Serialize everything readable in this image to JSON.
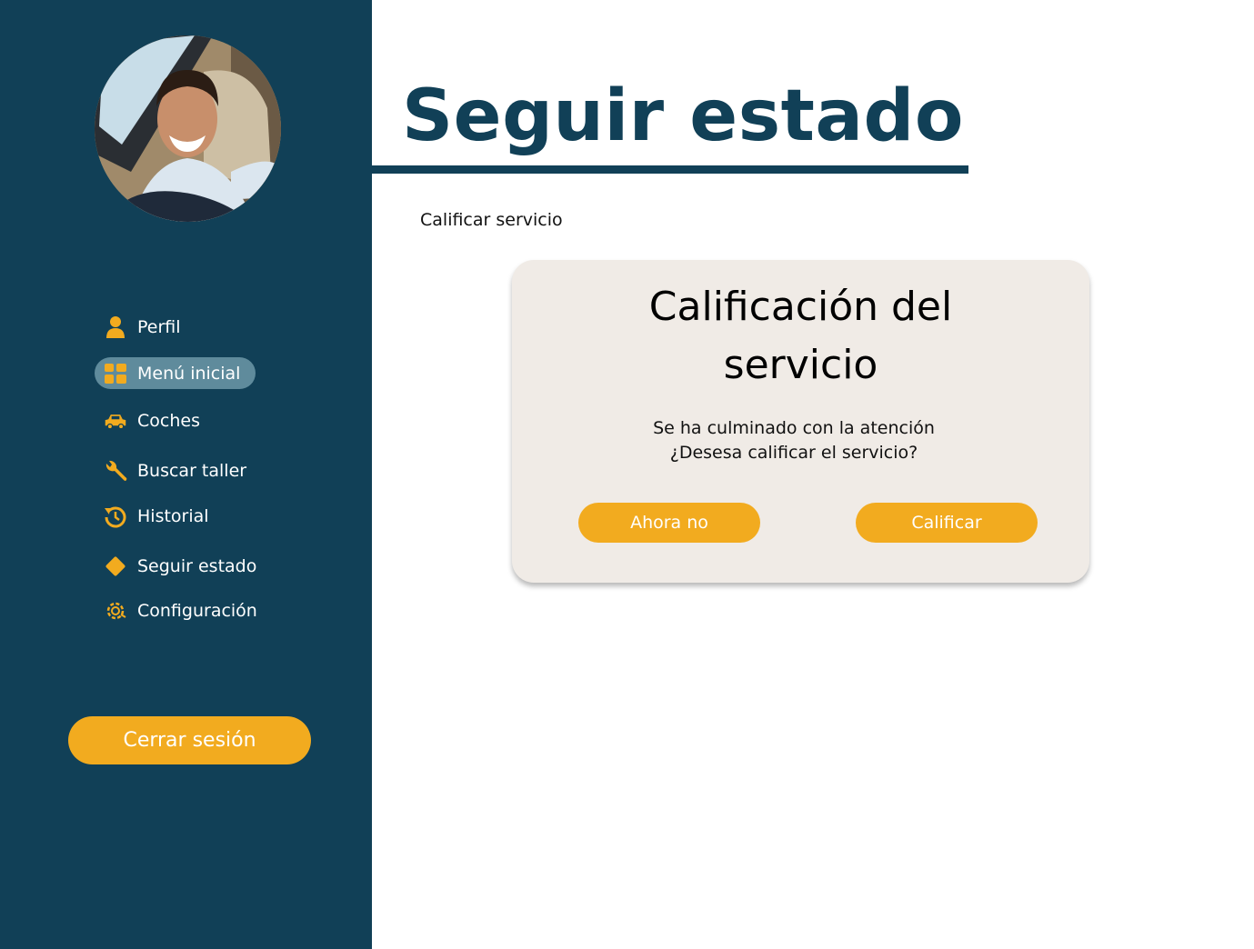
{
  "sidebar": {
    "avatar_alt": "Foto de perfil",
    "items": [
      {
        "label": "Perfil",
        "icon": "user-icon"
      },
      {
        "label": "Menú inicial",
        "icon": "grid-icon"
      },
      {
        "label": "Coches",
        "icon": "car-icon"
      },
      {
        "label": "Buscar taller",
        "icon": "wrench-icon"
      },
      {
        "label": "Historial",
        "icon": "history-icon"
      },
      {
        "label": "Seguir estado",
        "icon": "diamond-icon"
      },
      {
        "label": "Configuración",
        "icon": "settings-icon"
      }
    ],
    "active_item": "Menú inicial",
    "logout_label": "Cerrar sesión"
  },
  "main": {
    "title": "Seguir estado",
    "section_label": "Calificar servicio",
    "card": {
      "title_line1": "Calificación del",
      "title_line2": "servicio",
      "message_line1": "Se ha culminado con la atención",
      "message_line2": "¿Desesa calificar el servicio?",
      "decline_label": "Ahora no",
      "accept_label": "Calificar"
    }
  },
  "colors": {
    "sidebar_bg": "#114057",
    "accent": "#f2ab1f",
    "active_item_bg": "#5f8b9c",
    "card_bg": "#f0ebe6",
    "title_color": "#114057"
  }
}
